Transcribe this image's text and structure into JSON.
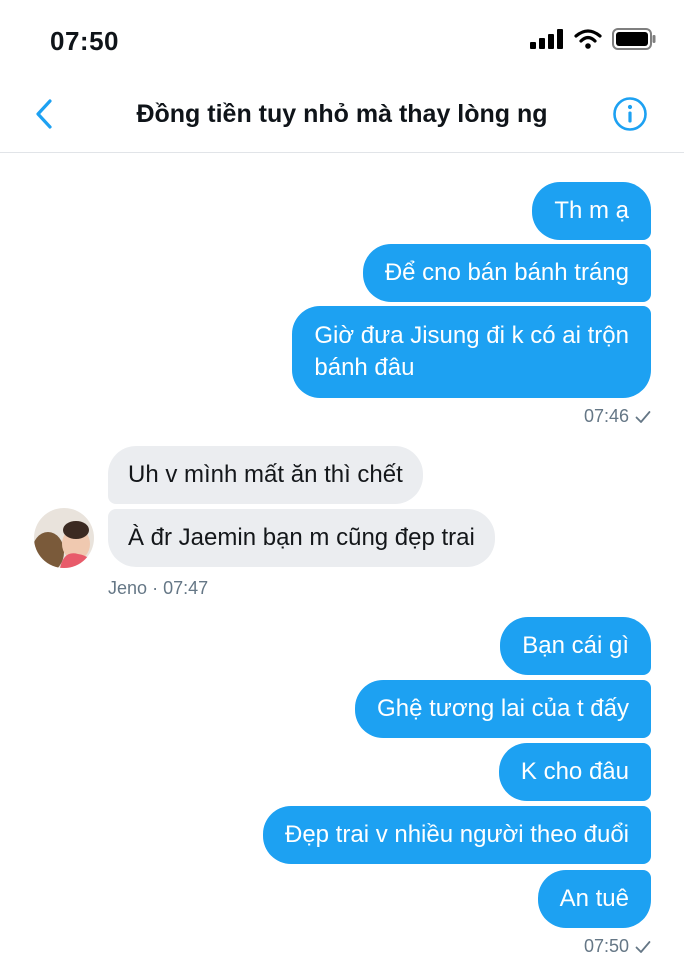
{
  "status_bar": {
    "time": "07:50"
  },
  "header": {
    "title": "Đồng tiền tuy nhỏ mà thay lòng ng"
  },
  "colors": {
    "accent": "#1da1f2",
    "incoming_bubble": "#ebedf0",
    "meta": "#657786"
  },
  "icons": {
    "back": "chevron-left-icon",
    "info": "info-icon",
    "read": "check-icon"
  },
  "messages": [
    {
      "side": "out",
      "text": "Th m ạ"
    },
    {
      "side": "out",
      "text": "Để cno bán bánh tráng"
    },
    {
      "side": "out",
      "line1": "Giờ đưa Jisung đi k có ai trộn",
      "line2": "bánh đâu"
    },
    {
      "side": "in",
      "text": "Uh v mình mất ăn thì chết"
    },
    {
      "side": "in",
      "text": "À đr Jaemin bạn m cũng đẹp trai"
    },
    {
      "side": "out",
      "text": "Bạn cái gì"
    },
    {
      "side": "out",
      "text": "Ghệ tương lai của t đấy"
    },
    {
      "side": "out",
      "text": "K cho đâu"
    },
    {
      "side": "out",
      "text": "Đẹp trai v nhiều người theo đuổi"
    },
    {
      "side": "out",
      "text": "An tuê"
    }
  ],
  "meta": {
    "out_time_1": "07:46",
    "in_sender": "Jeno",
    "in_separator": "·",
    "in_time": "07:47",
    "out_time_2": "07:50"
  }
}
